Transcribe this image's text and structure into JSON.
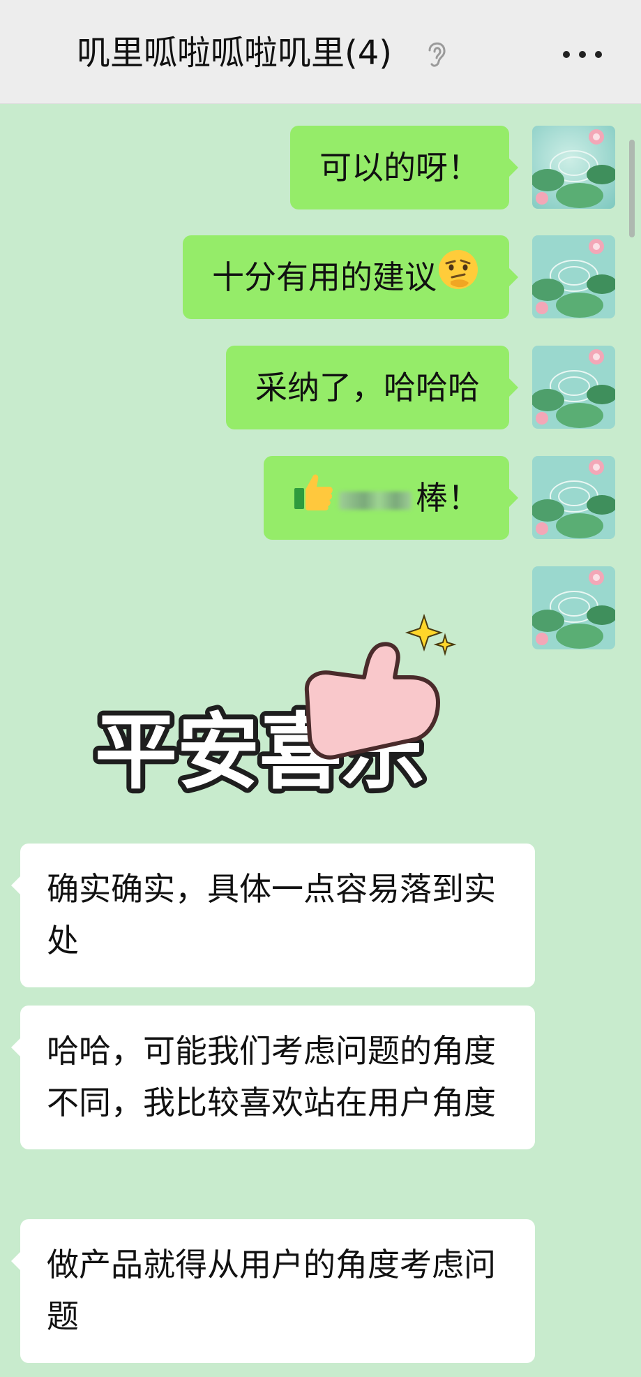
{
  "header": {
    "title": "叽里呱啦呱啦叽里(4)",
    "ear_icon": "ear-icon",
    "more_icon": "more-dots-icon"
  },
  "messages_sent": [
    {
      "text": "可以的呀！"
    },
    {
      "text": "十分有用的建议",
      "emoji": "thinking-face-emoji"
    },
    {
      "text": "采纳了，哈哈哈"
    },
    {
      "prefix_emoji": "thumbs-up-emoji",
      "text": "棒！"
    }
  ],
  "sticker": {
    "text": "平安喜乐",
    "icon": "sparkle-icon"
  },
  "messages_received": [
    {
      "text": "确实确实，具体一点容易落到实处"
    },
    {
      "text": "哈哈，可能我们考虑问题的角度不同，我比较喜欢站在用户角度"
    },
    {
      "text": "做产品就得从用户的角度考虑问题"
    }
  ],
  "colors": {
    "background": "#c8ebcd",
    "header": "#ededed",
    "sent_bubble": "#95ec69",
    "received_bubble": "#ffffff"
  }
}
